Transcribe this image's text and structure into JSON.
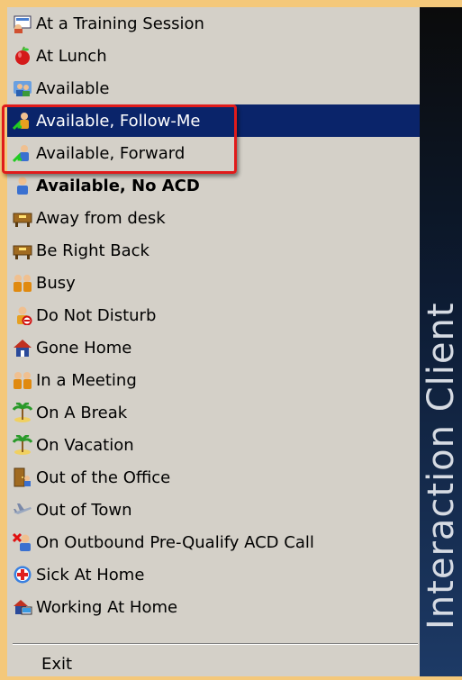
{
  "menu": {
    "items": [
      {
        "label": "At a Training Session",
        "icon": "training-session-icon"
      },
      {
        "label": "At Lunch",
        "icon": "apple-icon"
      },
      {
        "label": "Available",
        "icon": "users-available-icon"
      },
      {
        "label": "Available, Follow-Me",
        "icon": "user-follow-me-icon",
        "selected": true
      },
      {
        "label": "Available, Forward",
        "icon": "user-forward-icon"
      },
      {
        "label": "Available, No ACD",
        "icon": "user-no-acd-icon",
        "bold": true
      },
      {
        "label": "Away from desk",
        "icon": "desk-icon"
      },
      {
        "label": "Be Right Back",
        "icon": "desk-icon"
      },
      {
        "label": "Busy",
        "icon": "busy-users-icon"
      },
      {
        "label": "Do Not Disturb",
        "icon": "do-not-disturb-icon"
      },
      {
        "label": "Gone Home",
        "icon": "house-icon"
      },
      {
        "label": "In a Meeting",
        "icon": "meeting-users-icon"
      },
      {
        "label": "On A Break",
        "icon": "palm-tree-icon"
      },
      {
        "label": "On Vacation",
        "icon": "palm-tree-icon"
      },
      {
        "label": "Out of the Office",
        "icon": "office-door-icon"
      },
      {
        "label": "Out of Town",
        "icon": "airplane-icon"
      },
      {
        "label": "On Outbound Pre-Qualify ACD Call",
        "icon": "outbound-call-icon"
      },
      {
        "label": "Sick At Home",
        "icon": "medical-cross-icon"
      },
      {
        "label": "Working At Home",
        "icon": "home-computer-icon"
      }
    ],
    "exit_label": "Exit"
  },
  "sidebar": {
    "title": "Interaction Client"
  },
  "colors": {
    "selection": "#0a246a",
    "highlight_border": "#e01b1b",
    "menu_background": "#d4d0c8",
    "page_background": "#f4c87a"
  }
}
